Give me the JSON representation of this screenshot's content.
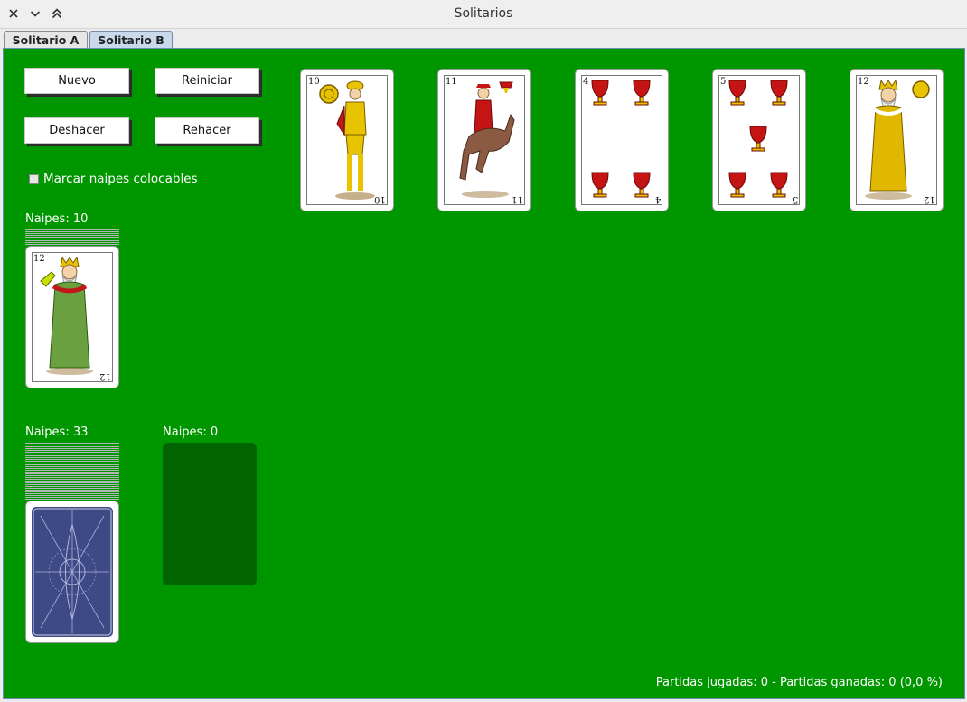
{
  "window": {
    "title": "Solitarios"
  },
  "tabs": [
    {
      "label": "Solitario A",
      "active": false
    },
    {
      "label": "Solitario B",
      "active": true
    }
  ],
  "toolbar": {
    "new_label": "Nuevo",
    "restart_label": "Reiniciar",
    "undo_label": "Deshacer",
    "redo_label": "Rehacer"
  },
  "options": {
    "mark_placeable_label": "Marcar naipes colocables",
    "mark_placeable_checked": false
  },
  "foundation": [
    {
      "rank": "10",
      "suit": "oros",
      "figure": "sota"
    },
    {
      "rank": "11",
      "suit": "copas",
      "figure": "caballo"
    },
    {
      "rank": "4",
      "suit": "copas",
      "figure": "pips"
    },
    {
      "rank": "5",
      "suit": "copas",
      "figure": "pips"
    },
    {
      "rank": "12",
      "suit": "oros",
      "figure": "rey"
    }
  ],
  "reserve": {
    "count_label": "Naipes: 10",
    "top_card": {
      "rank": "12",
      "suit": "bastos",
      "figure": "rey"
    }
  },
  "stock": {
    "count_label": "Naipes: 33"
  },
  "waste": {
    "count_label": "Naipes: 0"
  },
  "status": {
    "text": "Partidas jugadas: 0 - Partidas ganadas: 0 (0,0 %)"
  },
  "colors": {
    "felt": "#009600",
    "empty_slot": "#006400",
    "card_back": "#3e4a86",
    "cup_red": "#c41414",
    "gold": "#e8c400"
  }
}
